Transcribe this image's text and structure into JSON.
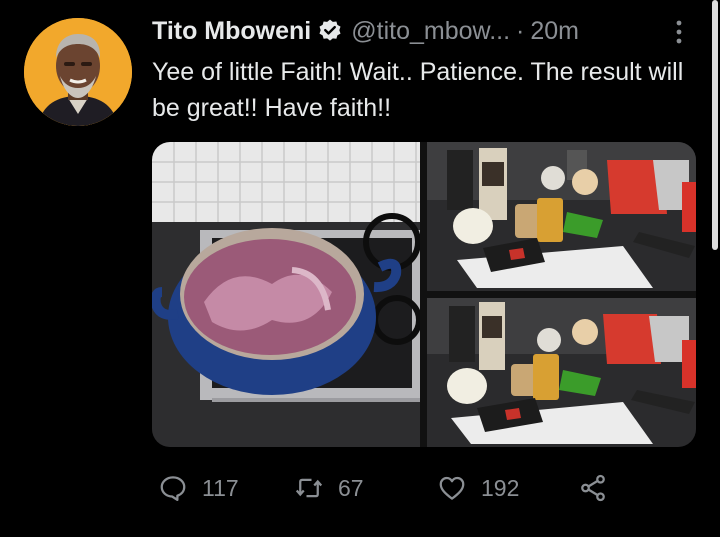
{
  "tweet": {
    "author_name": "Tito Mboweni",
    "handle": "@tito_mbow...",
    "separator": "·",
    "time": "20m",
    "text": "Yee of little Faith! Wait.. Patience. The result will be great!! Have faith!!",
    "verified": true
  },
  "actions": {
    "reply_count": "117",
    "retweet_count": "67",
    "like_count": "192"
  },
  "icons": {
    "reply": "speech-bubble-icon",
    "retweet": "retweet-arrows-icon",
    "like": "heart-icon",
    "share": "share-nodes-icon",
    "verified": "verified-badge-icon",
    "more": "more-vertical-icon"
  },
  "colors": {
    "background": "#000000",
    "text": "#e7e9ea",
    "muted": "#8b8f94",
    "verified_badge": "#e7e9ea"
  }
}
